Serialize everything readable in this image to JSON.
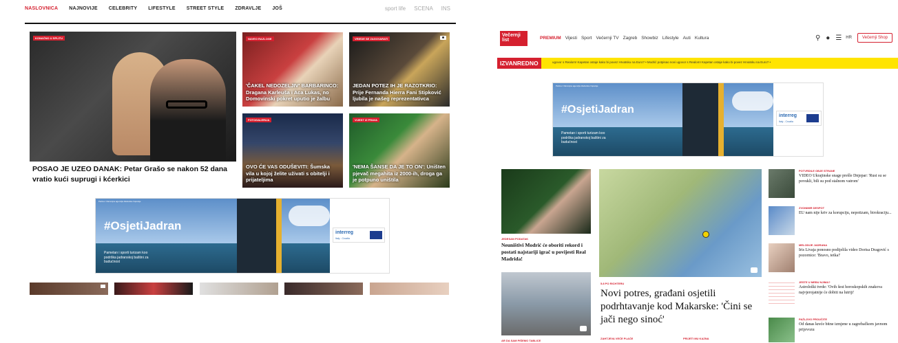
{
  "left_site": {
    "nav": {
      "items": [
        "NASLOVNICA",
        "NAJNOVIJE",
        "CELEBRITY",
        "LIFESTYLE",
        "STREET STYLE",
        "ZDRAVLJE",
        "JOŠ"
      ],
      "right": [
        "sport life",
        "SCENA",
        "INS"
      ]
    },
    "main_story": {
      "badge": "KONAČNO U SPLITU",
      "headline": "POSAO JE UZEO DANAK: Petar Grašo se nakon 52 dana vratio kući suprugi i kćerkici"
    },
    "tiles": [
      {
        "badge": "NAVEO RAZLOGE",
        "caption": "'ČAKEL NEDOZELJIV' BARBARINCO: Dragana Karleuša i Aca Lukas, no Domovinski pokret uputio je žalbu"
      },
      {
        "badge": "VRIEDE SE ZAGOVARATI",
        "caption": "JEDAN POTEZ IH JE RAZOTKRIO: Prije Fernanda Hierra Fani Stipković ljubila je našeg reprezentativca"
      },
      {
        "badge": "FOTOGALERIJA",
        "caption": "OVO ĆE VAS ODUŠEVITI: Šumska vila u kojoj želite uživati s obitelji i prijateljima"
      },
      {
        "badge": "VIJEST IZ PRAVA",
        "caption": "'NEMA ŠANSE DA JE TO ON': Uništen pjevač megahita iz 2000-ih, droga ga je potpuno uništila"
      }
    ],
    "ad": {
      "mini": "Partner: Razvojna agencija Zadarske županije",
      "hashtag": "#OsjetiJadran",
      "subtitle": "Pametan i sporti turizam koo podrška jadranskoj baštini za budućnost",
      "logo": "interreg",
      "logo_sub": "Italy - Croatia"
    }
  },
  "right_site": {
    "logo": "Večernji list",
    "nav": [
      "PREMIUM",
      "Vijesti",
      "Sport",
      "Večernji TV",
      "Zagreb",
      "Showbiz",
      "Lifestyle",
      "Auti",
      "Kultura"
    ],
    "lang": "HR",
    "shop": "Večernji Shop",
    "breaking_label": "IZVANREDNO",
    "breaking_text": "ugovor s Realom! Kapetan ostaje kako bi povez Hrvatsku na Euro? •  Modrić potpisao novi ugovor s Realom! Kapetan ostaje kako bi povez Hrvatsku na Euro? •",
    "ad": {
      "mini": "Partner: Razvojna agencija Zadarske županije",
      "hashtag": "#OsjetiJadran",
      "subtitle": "Pametan i sporti turizam koo podrška jadranskoj baštini za budućnost",
      "logo": "interreg",
      "logo_sub": "Italy - Croatia"
    },
    "left_story": {
      "kicker": "JEDESAN PODATAK",
      "headline": "Neuništivi Modrić će oboriti rekord i postati najstariji igrač u povijesti Real Madrida!"
    },
    "main_story": {
      "kicker": "5.8 PO RICHTERU",
      "headline": "Novi potres, građani osjetili podrhtavanje kod Makarske: 'Čini se jači nego sinoć'"
    },
    "bottom_kickers": [
      "AR DA SAM PIŠEMO TABLICE",
      "ZAHTJEVA VEĆE PLAĆE",
      "PRIJETI MU KAZNA"
    ],
    "side": [
      {
        "kicker": "POTVRDILE OBJE STRANE",
        "headline": "VIDEO Ukrajinske snage prešle Dnjepar: 'Rusi su se povukli, bili su pod stalnom vatrom'"
      },
      {
        "kicker": "ZVONIMIR DESPOT",
        "headline": "EU nam nije kriv za korupciju, nepotizam, birokraciju..."
      },
      {
        "kicker": "MELODIJE JADRANA",
        "headline": "Iris Livaja ponosno podijelila video Dorisa Dragović s pozornice: 'Bravo, tetka!'"
      },
      {
        "kicker": "JESTE U MEĐU NJIMA?",
        "headline": "Astrološki tvrde: 'Ovih šest horoskopskih znakova najvjerojatnije će dobiti na lutriji'"
      },
      {
        "kicker": "PAŽLJIVO PROUČITE",
        "headline": "Od danas kreće bitne izmjene u zagrebačkom javnom prijevozu"
      }
    ]
  },
  "colors": {
    "accent": "#d5202f",
    "breaking_bar": "#ffe400"
  }
}
